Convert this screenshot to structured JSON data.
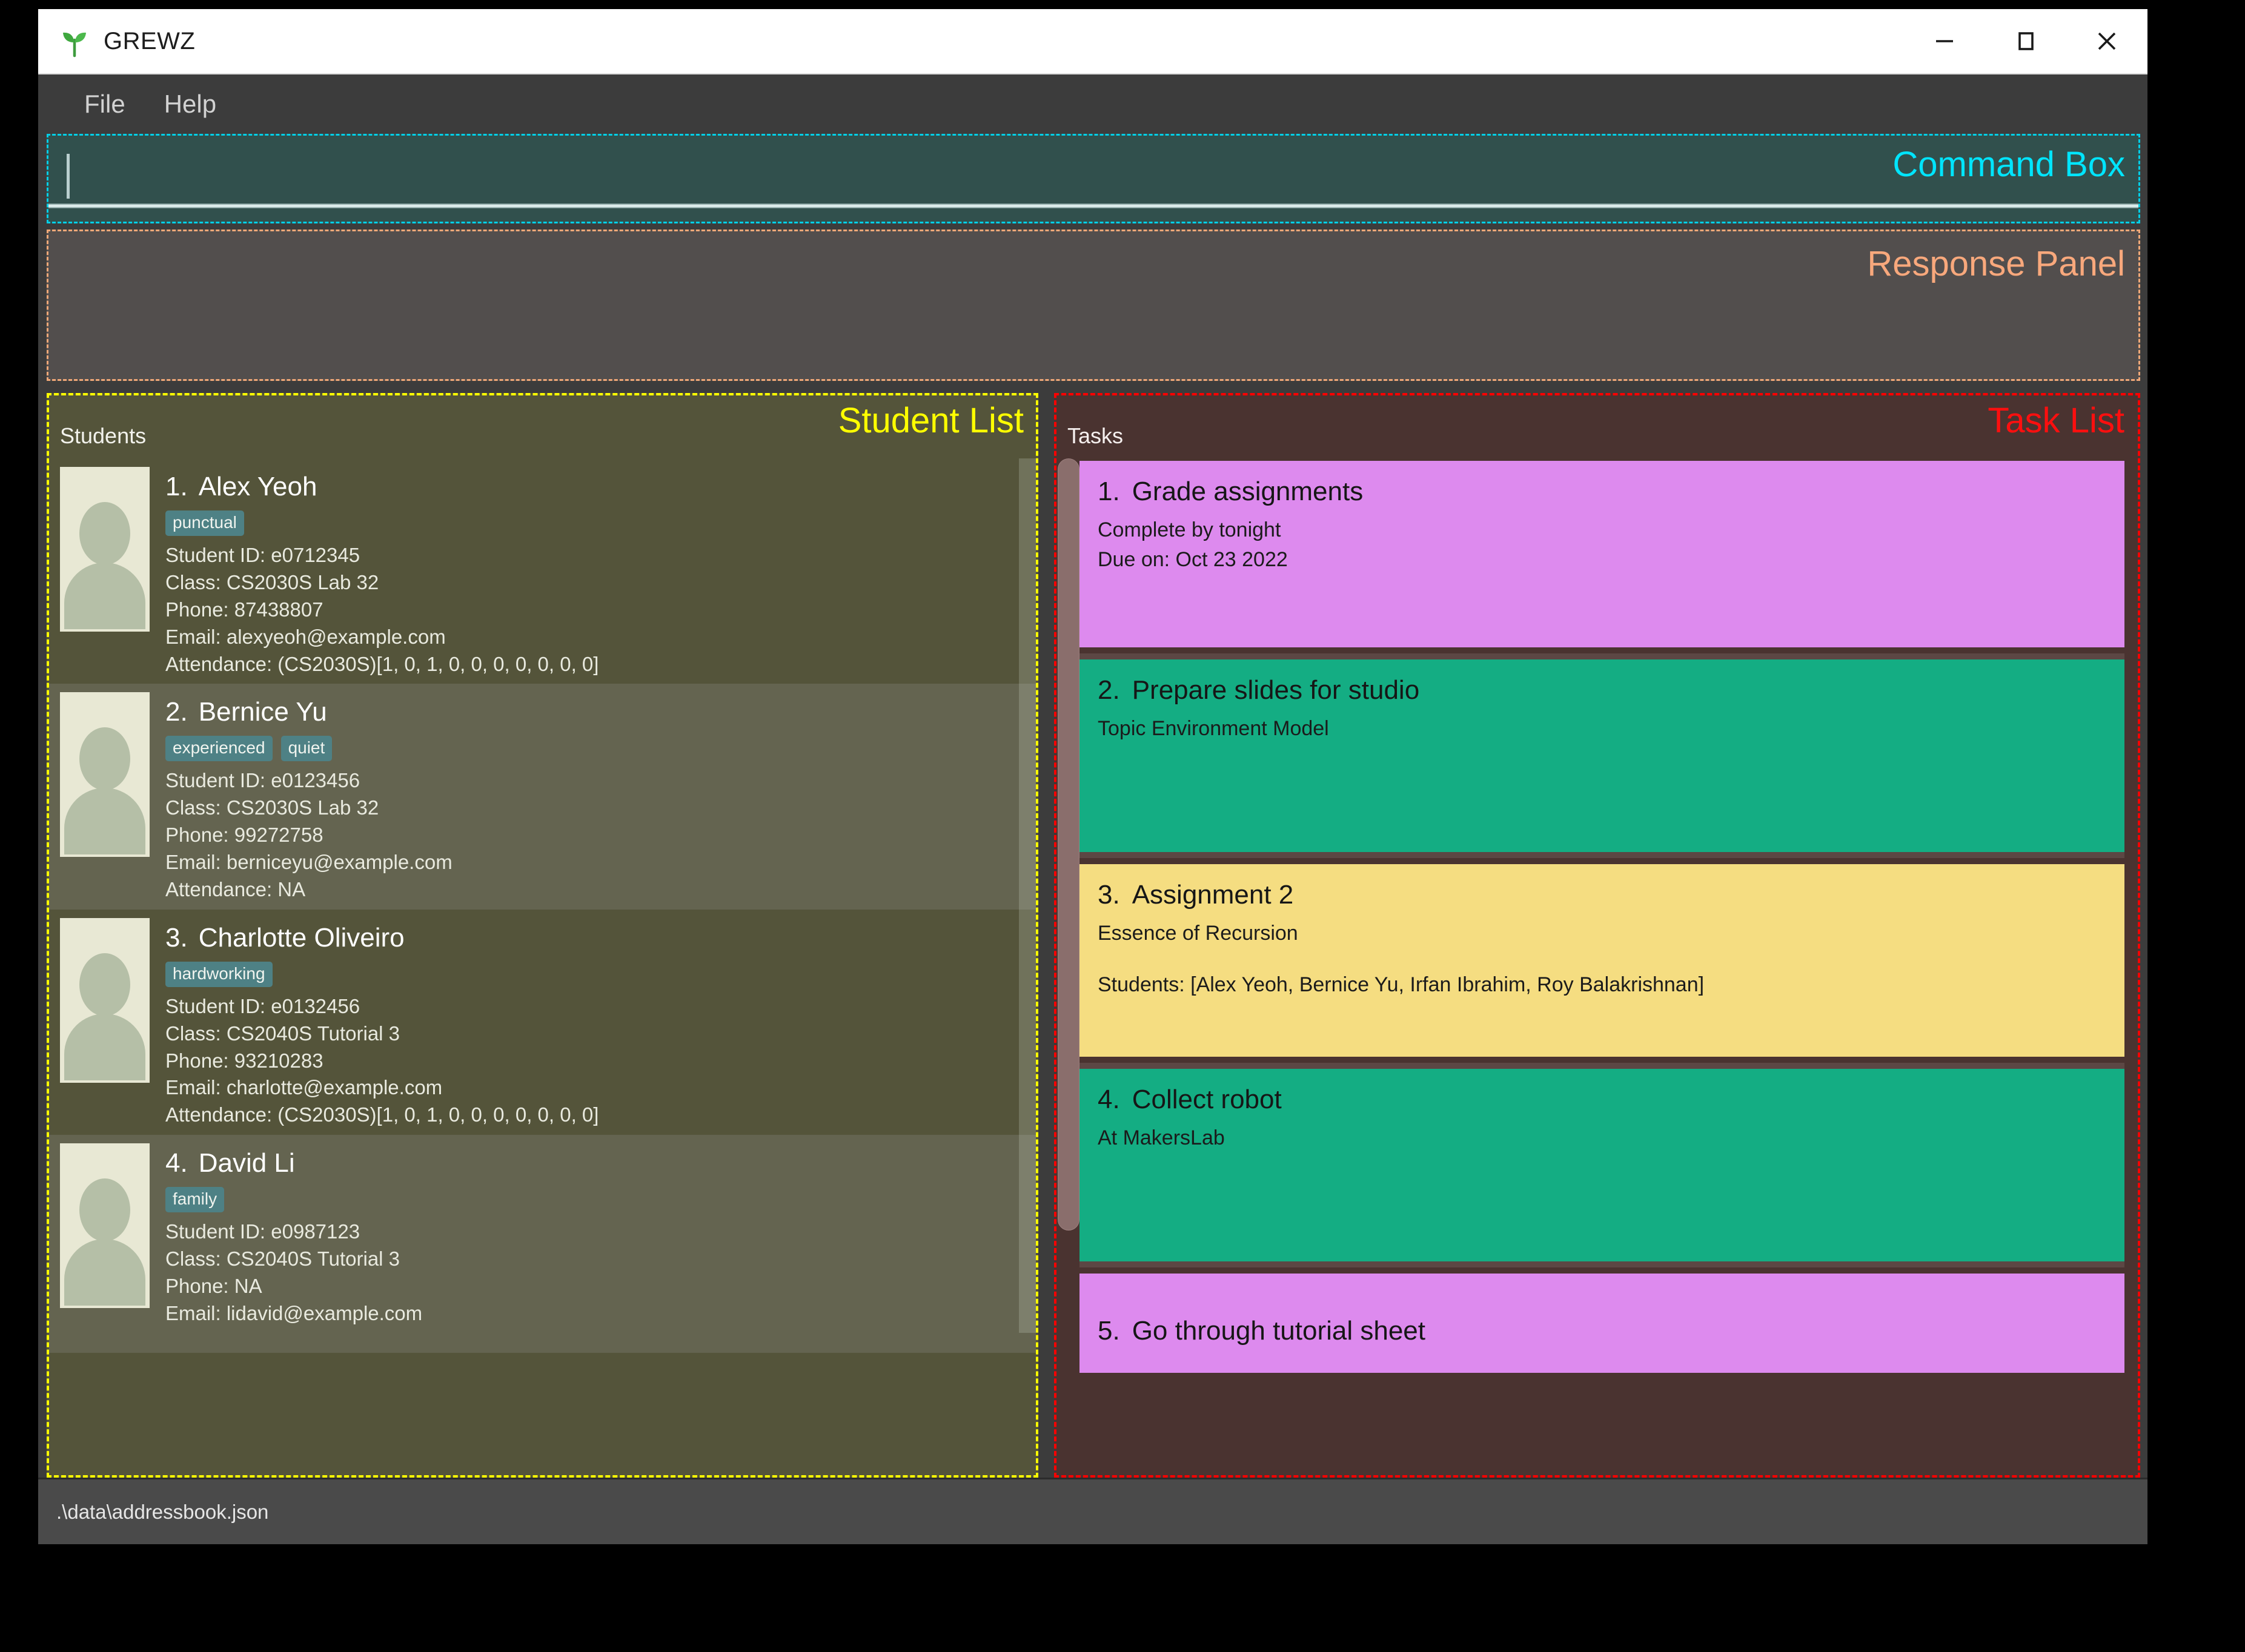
{
  "window": {
    "title": "GREWZ",
    "logo_icon": "sprout-icon",
    "controls": {
      "minimize": "minimize-icon",
      "maximize": "maximize-icon",
      "close": "close-icon"
    }
  },
  "menu": {
    "items": [
      {
        "label": "File"
      },
      {
        "label": "Help"
      }
    ]
  },
  "command_box": {
    "label": "Command Box",
    "value": "",
    "placeholder": "",
    "accent_color": "#00e5ff",
    "background_color": "#31504d"
  },
  "response_panel": {
    "label": "Response Panel",
    "text": "",
    "accent_color": "#f8a87c",
    "background_color": "#524e4d"
  },
  "student_list": {
    "label": "Student List",
    "heading": "Students",
    "accent_color": "#ffff00",
    "background_color": "#54543a",
    "students": [
      {
        "index": "1.",
        "name": "Alex Yeoh",
        "tags": [
          "punctual"
        ],
        "student_id": "Student ID: e0712345",
        "class": "Class: CS2030S Lab 32",
        "phone": "Phone: 87438807",
        "email": "Email: alexyeoh@example.com",
        "attendance": "Attendance: (CS2030S)[1, 0, 1, 0, 0, 0, 0, 0, 0, 0]"
      },
      {
        "index": "2.",
        "name": "Bernice Yu",
        "tags": [
          "experienced",
          "quiet"
        ],
        "student_id": "Student ID: e0123456",
        "class": "Class: CS2030S Lab 32",
        "phone": "Phone: 99272758",
        "email": "Email: berniceyu@example.com",
        "attendance": "Attendance: NA"
      },
      {
        "index": "3.",
        "name": "Charlotte Oliveiro",
        "tags": [
          "hardworking"
        ],
        "student_id": "Student ID: e0132456",
        "class": "Class: CS2040S Tutorial 3",
        "phone": "Phone: 93210283",
        "email": "Email: charlotte@example.com",
        "attendance": "Attendance: (CS2030S)[1, 0, 1, 0, 0, 0, 0, 0, 0, 0]"
      },
      {
        "index": "4.",
        "name": "David Li",
        "tags": [
          "family"
        ],
        "student_id": "Student ID: e0987123",
        "class": "Class: CS2040S Tutorial 3",
        "phone": "Phone: NA",
        "email": "Email: lidavid@example.com",
        "attendance": ""
      }
    ]
  },
  "task_list": {
    "label": "Task List",
    "heading": "Tasks",
    "accent_color": "#ff0f0f",
    "background_color": "#4a3330",
    "tasks": [
      {
        "index": "1.",
        "title": "Grade assignments",
        "lines": [
          "Complete by tonight",
          "Due on: Oct 23 2022"
        ],
        "spaced_line": "",
        "color": "#dd8aee"
      },
      {
        "index": "2.",
        "title": "Prepare slides for studio",
        "lines": [
          "Topic Environment Model"
        ],
        "spaced_line": "",
        "color": "#14ad83"
      },
      {
        "index": "3.",
        "title": "Assignment 2",
        "lines": [
          "Essence of Recursion"
        ],
        "spaced_line": "Students: [Alex Yeoh, Bernice Yu, Irfan Ibrahim, Roy Balakrishnan]",
        "color": "#f5dd81"
      },
      {
        "index": "4.",
        "title": "Collect robot",
        "lines": [
          "At MakersLab"
        ],
        "spaced_line": "",
        "color": "#14ad83"
      },
      {
        "index": "5.",
        "title": "Go through tutorial sheet",
        "lines": [],
        "spaced_line": "",
        "color": "#dd8aee"
      }
    ]
  },
  "status_bar": {
    "path": ".\\data\\addressbook.json"
  }
}
